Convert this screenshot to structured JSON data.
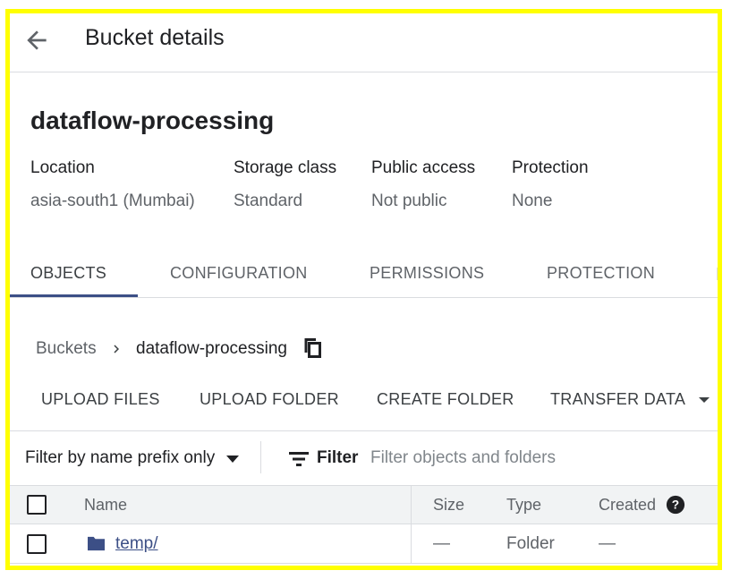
{
  "header": {
    "back_icon": "arrow-back-icon",
    "title": "Bucket details"
  },
  "bucket": {
    "name": "dataflow-processing",
    "location": {
      "label": "Location",
      "value": "asia-south1 (Mumbai)"
    },
    "storage_class": {
      "label": "Storage class",
      "value": "Standard"
    },
    "public_access": {
      "label": "Public access",
      "value": "Not public"
    },
    "protection": {
      "label": "Protection",
      "value": "None"
    }
  },
  "tabs": [
    {
      "label": "OBJECTS",
      "active": true
    },
    {
      "label": "CONFIGURATION",
      "active": false
    },
    {
      "label": "PERMISSIONS",
      "active": false
    },
    {
      "label": "PROTECTION",
      "active": false
    }
  ],
  "breadcrumb": {
    "root": "Buckets",
    "separator_icon": "chevron-right-icon",
    "current": "dataflow-processing",
    "copy_icon": "copy-icon"
  },
  "actions": {
    "upload_files": "UPLOAD FILES",
    "upload_folder": "UPLOAD FOLDER",
    "create_folder": "CREATE FOLDER",
    "transfer_data": "TRANSFER DATA"
  },
  "filter": {
    "prefix_mode": "Filter by name prefix only",
    "filter_label": "Filter",
    "placeholder": "Filter objects and folders"
  },
  "table": {
    "columns": {
      "name": "Name",
      "size": "Size",
      "type": "Type",
      "created": "Created"
    },
    "rows": [
      {
        "name": "temp/",
        "size": "—",
        "type": "Folder",
        "created": "—",
        "icon": "folder-icon"
      }
    ]
  },
  "colors": {
    "accent": "#3c4f86",
    "border_highlight": "#ffff00",
    "text_secondary": "#5f6368"
  }
}
